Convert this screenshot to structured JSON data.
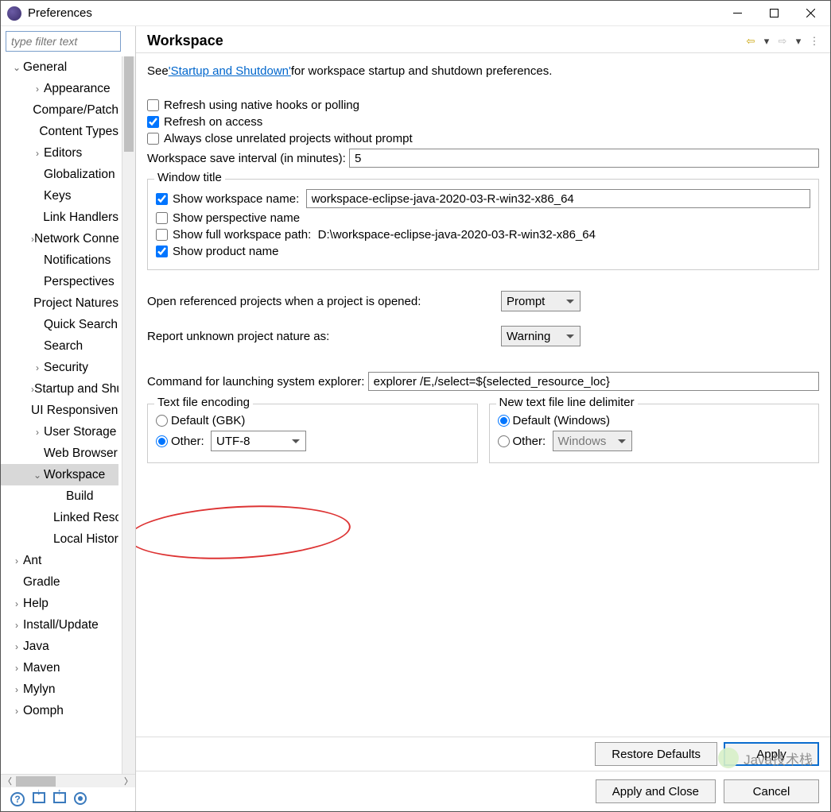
{
  "window": {
    "title": "Preferences"
  },
  "filter": {
    "placeholder": "type filter text"
  },
  "tree": [
    {
      "label": "General",
      "depth": 1,
      "tw": "v"
    },
    {
      "label": "Appearance",
      "depth": 2,
      "tw": ">"
    },
    {
      "label": "Compare/Patch",
      "depth": 2,
      "tw": ""
    },
    {
      "label": "Content Types",
      "depth": 2,
      "tw": ""
    },
    {
      "label": "Editors",
      "depth": 2,
      "tw": ">"
    },
    {
      "label": "Globalization",
      "depth": 2,
      "tw": ""
    },
    {
      "label": "Keys",
      "depth": 2,
      "tw": ""
    },
    {
      "label": "Link Handlers",
      "depth": 2,
      "tw": ""
    },
    {
      "label": "Network Connections",
      "depth": 2,
      "tw": ">"
    },
    {
      "label": "Notifications",
      "depth": 2,
      "tw": ""
    },
    {
      "label": "Perspectives",
      "depth": 2,
      "tw": ""
    },
    {
      "label": "Project Natures",
      "depth": 2,
      "tw": ""
    },
    {
      "label": "Quick Search",
      "depth": 2,
      "tw": ""
    },
    {
      "label": "Search",
      "depth": 2,
      "tw": ""
    },
    {
      "label": "Security",
      "depth": 2,
      "tw": ">"
    },
    {
      "label": "Startup and Shutdown",
      "depth": 2,
      "tw": ">"
    },
    {
      "label": "UI Responsiveness",
      "depth": 2,
      "tw": ""
    },
    {
      "label": "User Storage",
      "depth": 2,
      "tw": ">"
    },
    {
      "label": "Web Browser",
      "depth": 2,
      "tw": ""
    },
    {
      "label": "Workspace",
      "depth": 2,
      "tw": "v",
      "sel": true
    },
    {
      "label": "Build",
      "depth": 3,
      "tw": ""
    },
    {
      "label": "Linked Resources",
      "depth": 3,
      "tw": ""
    },
    {
      "label": "Local History",
      "depth": 3,
      "tw": ""
    },
    {
      "label": "Ant",
      "depth": 1,
      "tw": ">"
    },
    {
      "label": "Gradle",
      "depth": 1,
      "tw": ""
    },
    {
      "label": "Help",
      "depth": 1,
      "tw": ">"
    },
    {
      "label": "Install/Update",
      "depth": 1,
      "tw": ">"
    },
    {
      "label": "Java",
      "depth": 1,
      "tw": ">"
    },
    {
      "label": "Maven",
      "depth": 1,
      "tw": ">"
    },
    {
      "label": "Mylyn",
      "depth": 1,
      "tw": ">"
    },
    {
      "label": "Oomph",
      "depth": 1,
      "tw": ">"
    }
  ],
  "page": {
    "title": "Workspace",
    "see_prefix": "See ",
    "see_link": "'Startup and Shutdown'",
    "see_suffix": " for workspace startup and shutdown preferences.",
    "refresh_native": "Refresh using native hooks or polling",
    "refresh_access": "Refresh on access",
    "always_close": "Always close unrelated projects without prompt",
    "save_interval_label": "Workspace save interval (in minutes):",
    "save_interval_value": "5",
    "window_title_group": "Window title",
    "show_ws_name": "Show workspace name:",
    "ws_name_value": "workspace-eclipse-java-2020-03-R-win32-x86_64",
    "show_perspective": "Show perspective name",
    "show_full_path": "Show full workspace path:",
    "full_path_value": "D:\\workspace-eclipse-java-2020-03-R-win32-x86_64",
    "show_product": "Show product name",
    "open_referenced_label": "Open referenced projects when a project is opened:",
    "open_referenced_value": "Prompt",
    "report_nature_label": "Report unknown project nature as:",
    "report_nature_value": "Warning",
    "explorer_label": "Command for launching system explorer:",
    "explorer_value": "explorer /E,/select=${selected_resource_loc}",
    "encoding_group": "Text file encoding",
    "encoding_default": "Default (GBK)",
    "encoding_other": "Other:",
    "encoding_other_value": "UTF-8",
    "delimiter_group": "New text file line delimiter",
    "delimiter_default": "Default (Windows)",
    "delimiter_other": "Other:",
    "delimiter_other_value": "Windows"
  },
  "buttons": {
    "restore": "Restore Defaults",
    "apply": "Apply",
    "apply_close": "Apply and Close",
    "cancel": "Cancel"
  },
  "watermark": "Java技术栈"
}
